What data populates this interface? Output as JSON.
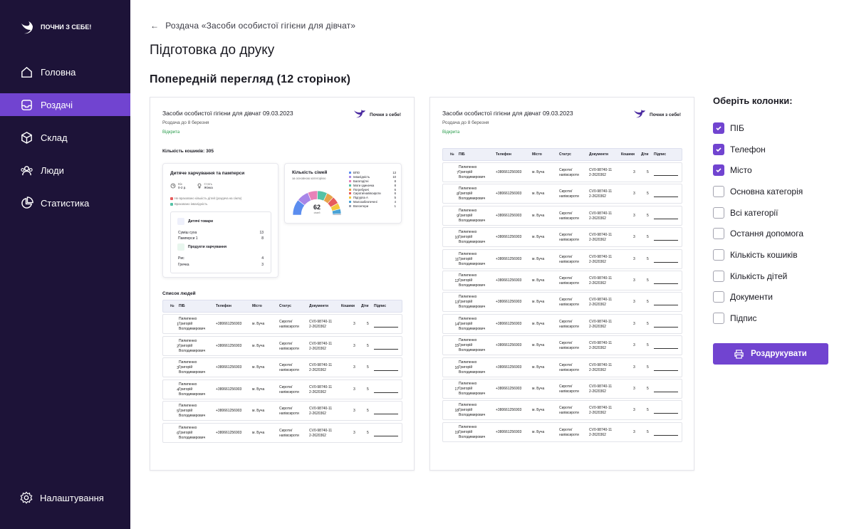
{
  "app": {
    "logo_text": "ПОЧНИ З СЕБЕ!"
  },
  "nav": {
    "items": [
      {
        "label": "Головна"
      },
      {
        "label": "Роздачі"
      },
      {
        "label": "Склад"
      },
      {
        "label": "Люди"
      },
      {
        "label": "Статистика"
      }
    ],
    "settings": "Налаштування"
  },
  "header": {
    "breadcrumb": "Роздача «Засоби особистої гігієни для дівчат»",
    "title": "Підготовка до друку",
    "preview": "Попередній перегляд (12 сторінок)"
  },
  "doc": {
    "title": "Засоби особистої гігієни для дівчат 09.03.2023",
    "date": "Роздача до 8 березня",
    "status": "Відкрита",
    "logo": "Почни з себе!",
    "baskets": "Кількість кошиків: 305",
    "cardA": {
      "title": "Дитяче харчування та памперси",
      "age_l": "Вік",
      "age_v": "0-2 р.",
      "sex_l": "Стать",
      "sex_v": "Жінка",
      "note1": "Не враховано кількість дітей (роздача на сім'ю)",
      "note2": "Враховано інвалідність",
      "g1": "Дитячі товари",
      "g1_items": [
        {
          "n": "Суміш суха",
          "q": "13"
        },
        {
          "n": "Памперси 1",
          "q": "8"
        }
      ],
      "g2": "Продукти харчування",
      "g2_items": [
        {
          "n": "Рис",
          "q": "4"
        },
        {
          "n": "Гречка",
          "q": "3"
        }
      ]
    },
    "cardB": {
      "title": "Кількість сімей",
      "sub": "за основною категорією",
      "total": "62",
      "total_l": "сімей",
      "legend": [
        {
          "n": "ВПО",
          "v": "13",
          "c": "#5b8def"
        },
        {
          "n": "Інвалідність",
          "v": "10",
          "c": "#a886e8"
        },
        {
          "n": "Багатодітні",
          "v": "8",
          "c": "#e882b9"
        },
        {
          "n": "Мати одиначка",
          "v": "8",
          "c": "#55c2a6"
        },
        {
          "n": "Погребуючі",
          "v": "6",
          "c": "#e7a24a"
        },
        {
          "n": "Сироти/напівсироти",
          "v": "6",
          "c": "#e65c5c"
        },
        {
          "n": "Підгурпа А",
          "v": "5",
          "c": "#f3c83c"
        },
        {
          "n": "Малозабезпечені",
          "v": "4",
          "c": "#4aa3d6"
        },
        {
          "n": "Волонтери",
          "v": "1",
          "c": "#9aa0b0"
        }
      ]
    },
    "list_title": "Список людей",
    "cols": [
      "№",
      "ПІБ",
      "Телефон",
      "Місто",
      "Статус",
      "Документи",
      "Кошики",
      "Діти",
      "Підпис"
    ],
    "person": {
      "name1": "Пилипенко",
      "name2": "Григорій",
      "name3": "Володимирович",
      "phone": "+380661256903",
      "city": "м. Буча",
      "status1": "Сироти/",
      "status2": "напівсироти",
      "doc1": "CV0-98740-11",
      "doc2": "2-2620362",
      "baskets": "3",
      "kids": "5"
    },
    "page1_rows": [
      "1",
      "2",
      "3",
      "4",
      "5",
      "6"
    ],
    "page2_rows": [
      "7",
      "8",
      "9",
      "10",
      "11",
      "12",
      "13",
      "14",
      "15",
      "16",
      "17",
      "18",
      "19"
    ]
  },
  "panel": {
    "title": "Оберіть колонки:",
    "options": [
      {
        "label": "ПІБ",
        "checked": true
      },
      {
        "label": "Телефон",
        "checked": true
      },
      {
        "label": "Місто",
        "checked": true
      },
      {
        "label": "Основна категорія",
        "checked": false
      },
      {
        "label": "Всі категорії",
        "checked": false
      },
      {
        "label": "Остання допомога",
        "checked": false
      },
      {
        "label": "Кількість кошиків",
        "checked": false
      },
      {
        "label": "Кількість дітей",
        "checked": false
      },
      {
        "label": "Документи",
        "checked": false
      },
      {
        "label": "Підпис",
        "checked": false
      }
    ],
    "print": "Роздрукувати"
  },
  "colors": {
    "accent": "#7144d0",
    "sidebar": "#1d1338",
    "open": "#2a9c4c"
  }
}
